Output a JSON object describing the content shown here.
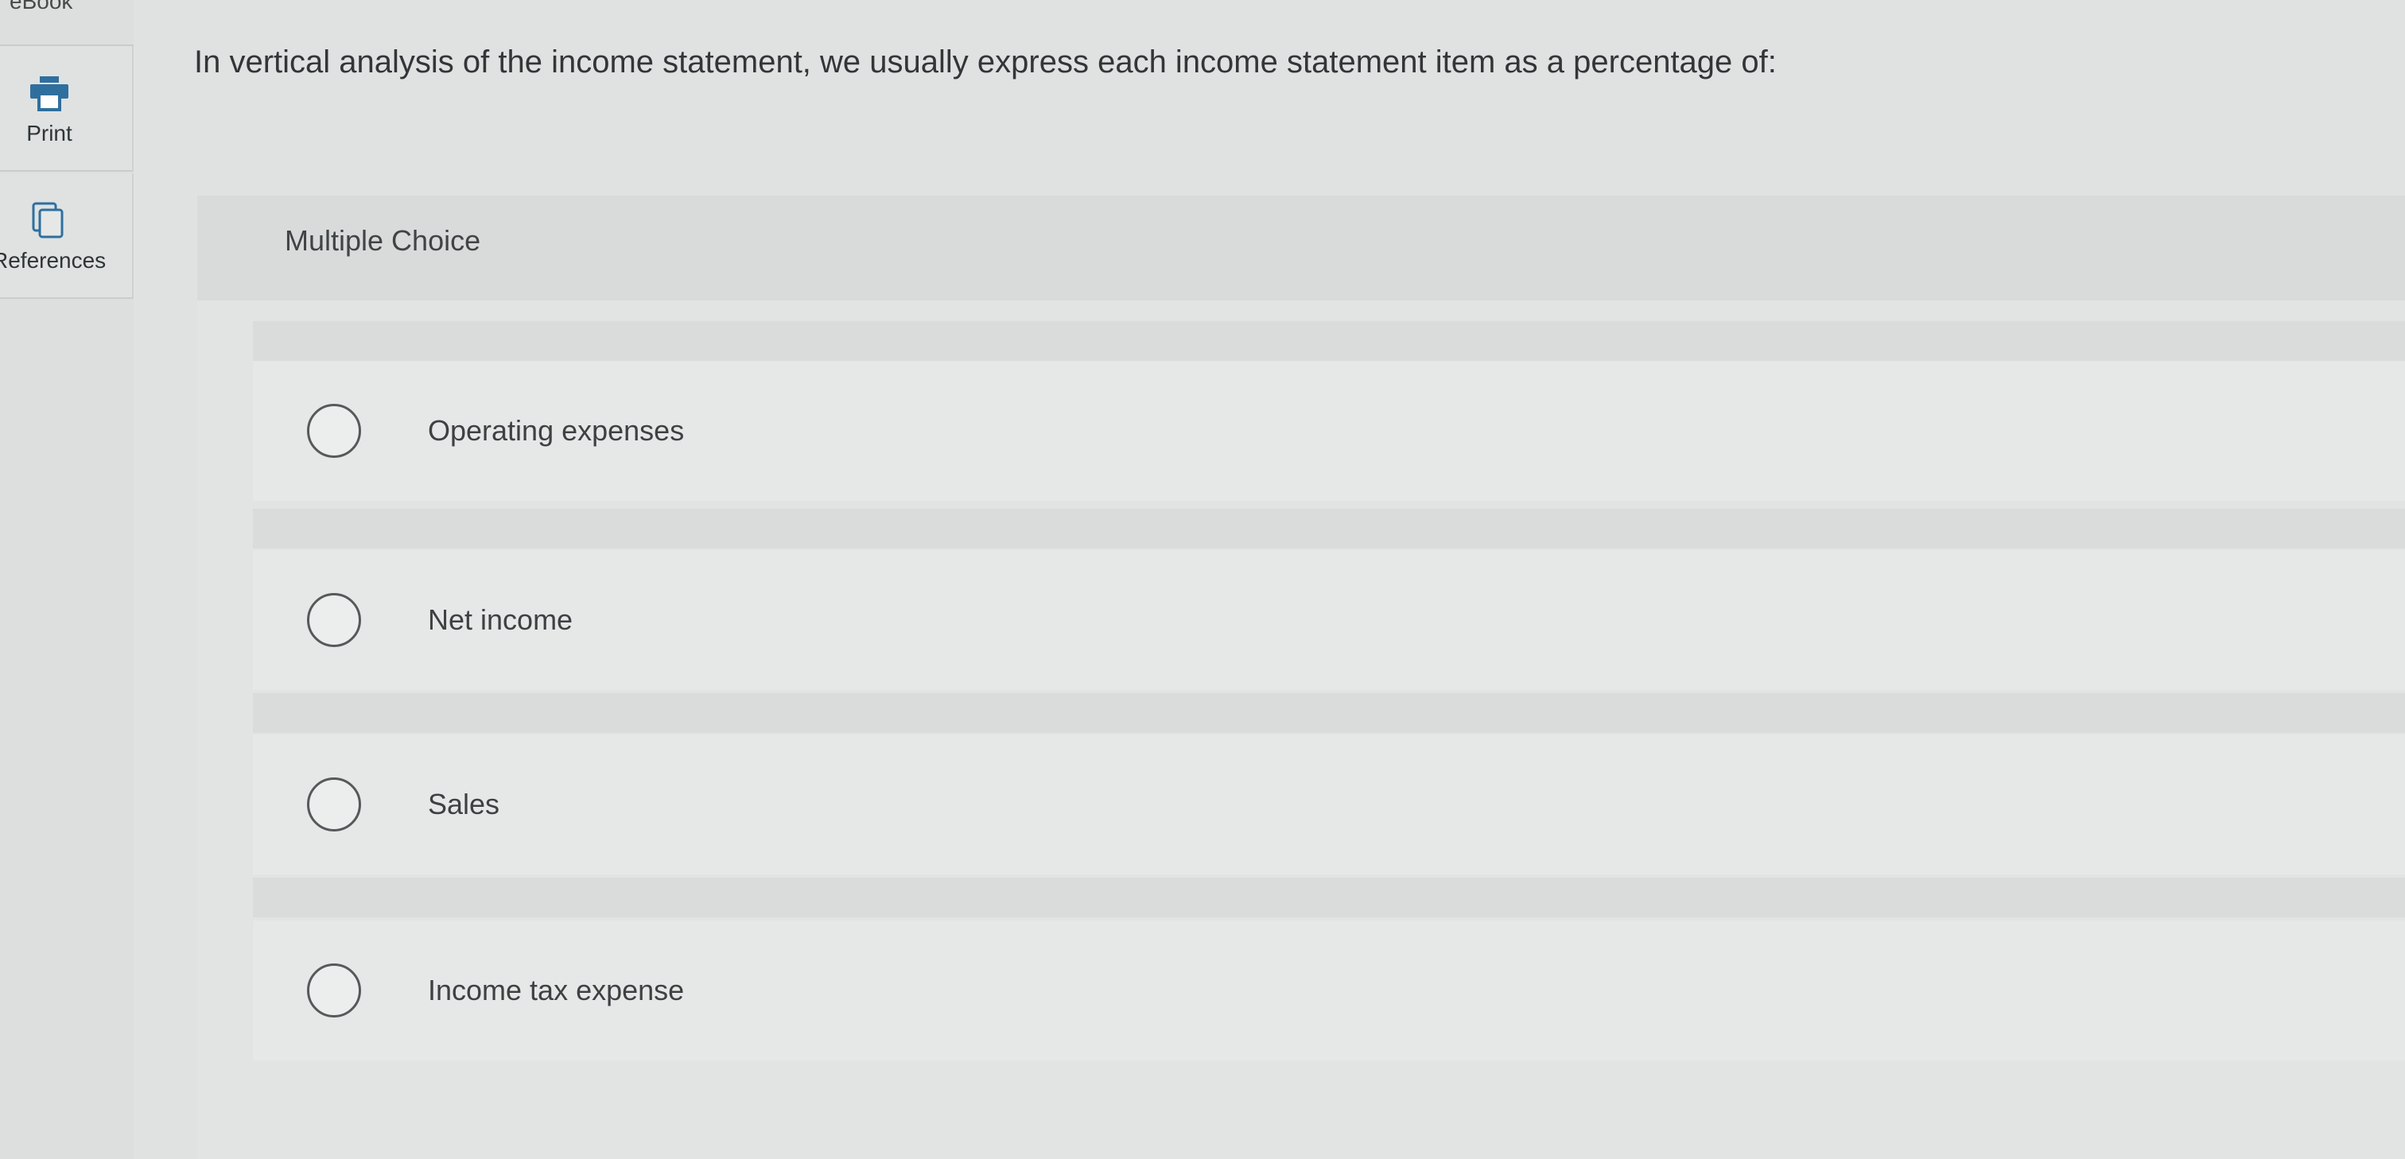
{
  "rail": {
    "top_label": "eBook",
    "print_label": "Print",
    "print_icon": "printer-icon",
    "references_label": "References",
    "references_icon": "copy-pages-icon"
  },
  "question": {
    "text": "In vertical analysis of the income statement, we usually express each income statement item as a percentage of:"
  },
  "multiple_choice": {
    "header": "Multiple Choice",
    "options": [
      {
        "label": "Operating expenses",
        "selected": false
      },
      {
        "label": "Net income",
        "selected": false
      },
      {
        "label": "Sales",
        "selected": false
      },
      {
        "label": "Income tax expense",
        "selected": false
      }
    ]
  },
  "colors": {
    "background": "#dfe2e1",
    "text": "#333538",
    "radio_border": "#56595b"
  }
}
